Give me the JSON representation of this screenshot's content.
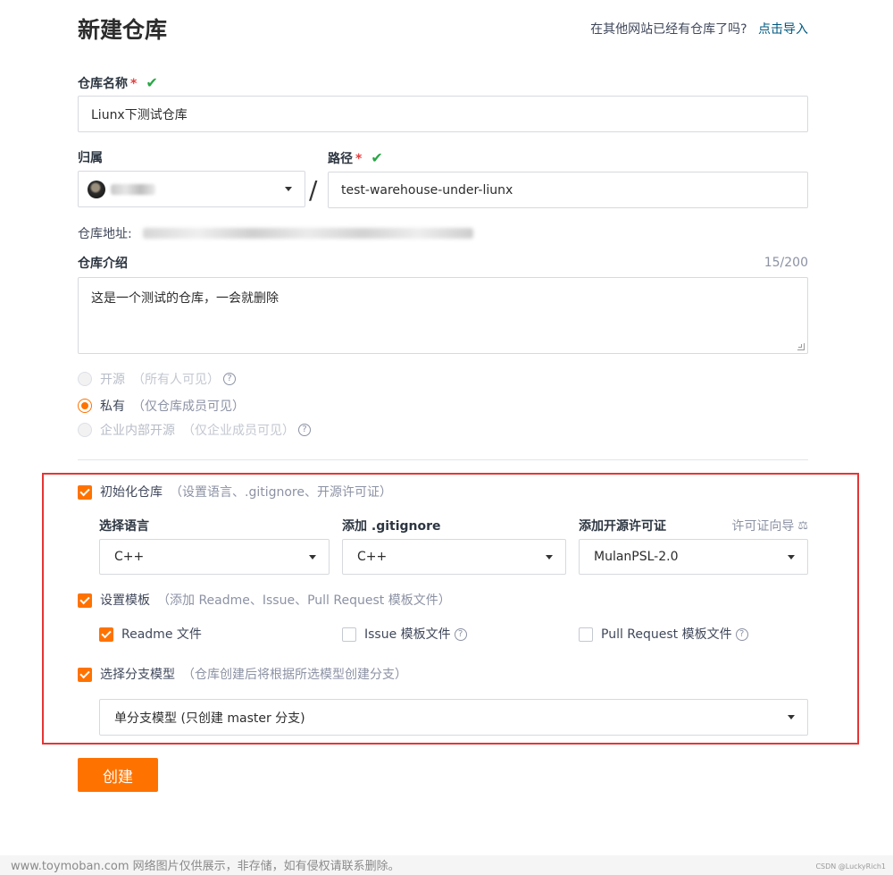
{
  "header": {
    "title": "新建仓库",
    "import_prompt": "在其他网站已经有仓库了吗?",
    "import_link": "点击导入"
  },
  "repo_name": {
    "label": "仓库名称",
    "required_mark": "*",
    "valid_mark": "✔",
    "value": "Liunx下测试仓库"
  },
  "owner": {
    "label": "归属"
  },
  "path": {
    "label": "路径",
    "required_mark": "*",
    "valid_mark": "✔",
    "separator": "/",
    "value": "test-warehouse-under-liunx"
  },
  "address": {
    "label": "仓库地址:"
  },
  "description": {
    "label": "仓库介绍",
    "counter": "15/200",
    "value": "这是一个测试的仓库，一会就删除"
  },
  "visibility": {
    "options": [
      {
        "label": "开源",
        "hint": "（所有人可见）",
        "has_help": true,
        "state": "disabled"
      },
      {
        "label": "私有",
        "hint": "（仅仓库成员可见）",
        "has_help": false,
        "state": "selected"
      },
      {
        "label": "企业内部开源",
        "hint": "（仅企业成员可见）",
        "has_help": true,
        "state": "disabled"
      }
    ]
  },
  "init": {
    "checkbox_label": "初始化仓库",
    "checkbox_hint": "（设置语言、.gitignore、开源许可证）",
    "checked": true,
    "language": {
      "label": "选择语言",
      "value": "C++"
    },
    "gitignore": {
      "label": "添加 .gitignore",
      "value": "C++"
    },
    "license": {
      "label": "添加开源许可证",
      "guide": "许可证向导",
      "value": "MulanPSL-2.0"
    }
  },
  "template": {
    "checkbox_label": "设置模板",
    "checkbox_hint": "（添加 Readme、Issue、Pull Request 模板文件）",
    "checked": true,
    "files": [
      {
        "label": "Readme 文件",
        "checked": true,
        "has_help": false
      },
      {
        "label": "Issue 模板文件",
        "checked": false,
        "has_help": true
      },
      {
        "label": "Pull Request 模板文件",
        "checked": false,
        "has_help": true
      }
    ]
  },
  "branch": {
    "checkbox_label": "选择分支模型",
    "checkbox_hint": "（仓库创建后将根据所选模型创建分支）",
    "checked": true,
    "value": "单分支模型 (只创建 master 分支)"
  },
  "actions": {
    "create": "创建"
  },
  "footer": {
    "watermark": "www.toymoban.com 网络图片仅供展示，非存储，如有侵权请联系删除。",
    "credit": "CSDN @LuckyRich1"
  },
  "colors": {
    "accent": "#fe7300",
    "link": "#005980",
    "valid": "#28a745",
    "required": "#e63e3e",
    "highlight_frame": "#e63535"
  },
  "icons": {
    "valid": "check-icon",
    "dropdown": "caret-down-icon",
    "help": "question-circle-icon",
    "license_guide": "scale-icon"
  }
}
